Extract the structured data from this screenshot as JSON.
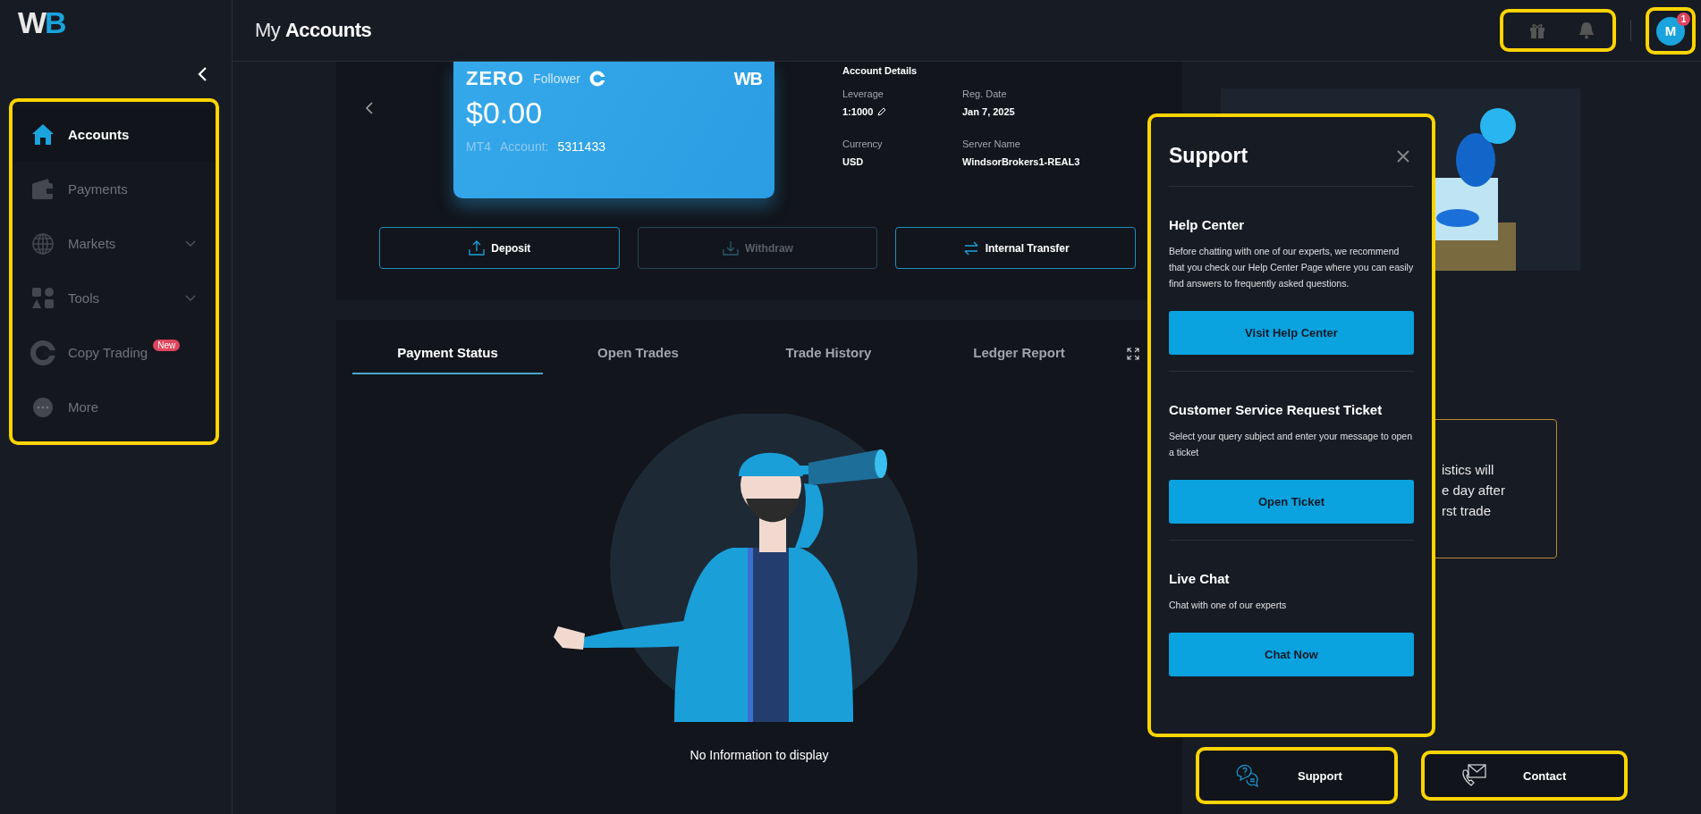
{
  "brand": {
    "logo_text_main": "W",
    "logo_text_accent": "B"
  },
  "header": {
    "title": "My **Accounts**",
    "notification_count": "1",
    "avatar_initial": "M"
  },
  "sidebar": {
    "items": [
      {
        "label": "Accounts",
        "selected": true,
        "has_submenu": false
      },
      {
        "label": "Payments",
        "selected": false,
        "has_submenu": false
      },
      {
        "label": "Markets",
        "selected": false,
        "has_submenu": true
      },
      {
        "label": "Tools",
        "selected": false,
        "has_submenu": true
      },
      {
        "label": "Copy Trading",
        "selected": false,
        "has_submenu": false,
        "badge": "New"
      },
      {
        "label": "More",
        "selected": false,
        "has_submenu": false
      }
    ]
  },
  "account_card": {
    "type": "ZERO",
    "role": "Follower",
    "logo": "WB",
    "balance": "$0.00",
    "platform": "MT4",
    "account_label": "Account:",
    "account_number": "5311433"
  },
  "account_details": {
    "title": "Account Details",
    "fields": [
      {
        "label": "Leverage",
        "value": "1:1000",
        "editable": true
      },
      {
        "label": "Reg. Date",
        "value": "Jan 7, 2025",
        "editable": false
      },
      {
        "label": "Currency",
        "value": "USD",
        "editable": false
      },
      {
        "label": "Server Name",
        "value": "WindsorBrokers1-REAL3",
        "editable": false
      }
    ]
  },
  "actions": [
    {
      "label": "Deposit",
      "disabled": false
    },
    {
      "label": "Withdraw",
      "disabled": true
    },
    {
      "label": "Internal Transfer",
      "disabled": false
    }
  ],
  "tabs": [
    {
      "label": "Payment Status",
      "selected": true
    },
    {
      "label": "Open Trades",
      "selected": false
    },
    {
      "label": "Trade History",
      "selected": false
    },
    {
      "label": "Ledger Report",
      "selected": false
    }
  ],
  "empty_state": {
    "message": "No Information to display"
  },
  "stats_notice": {
    "lines": [
      "istics will",
      "e day after",
      "rst trade"
    ]
  },
  "support_panel": {
    "title": "Support",
    "sections": [
      {
        "heading": "Help Center",
        "text": "Before chatting with one of our experts, we recommend that you check our Help Center Page where you can easily find answers to frequently asked questions.",
        "button": "Visit Help Center"
      },
      {
        "heading": "Customer Service Request Ticket",
        "text": "Select your query subject and enter your message to open a ticket",
        "button": "Open Ticket"
      },
      {
        "heading": "Live Chat",
        "text": "Chat with one of our experts",
        "button": "Chat Now"
      }
    ]
  },
  "footer_buttons": [
    {
      "label": "Support"
    },
    {
      "label": "Contact"
    }
  ]
}
